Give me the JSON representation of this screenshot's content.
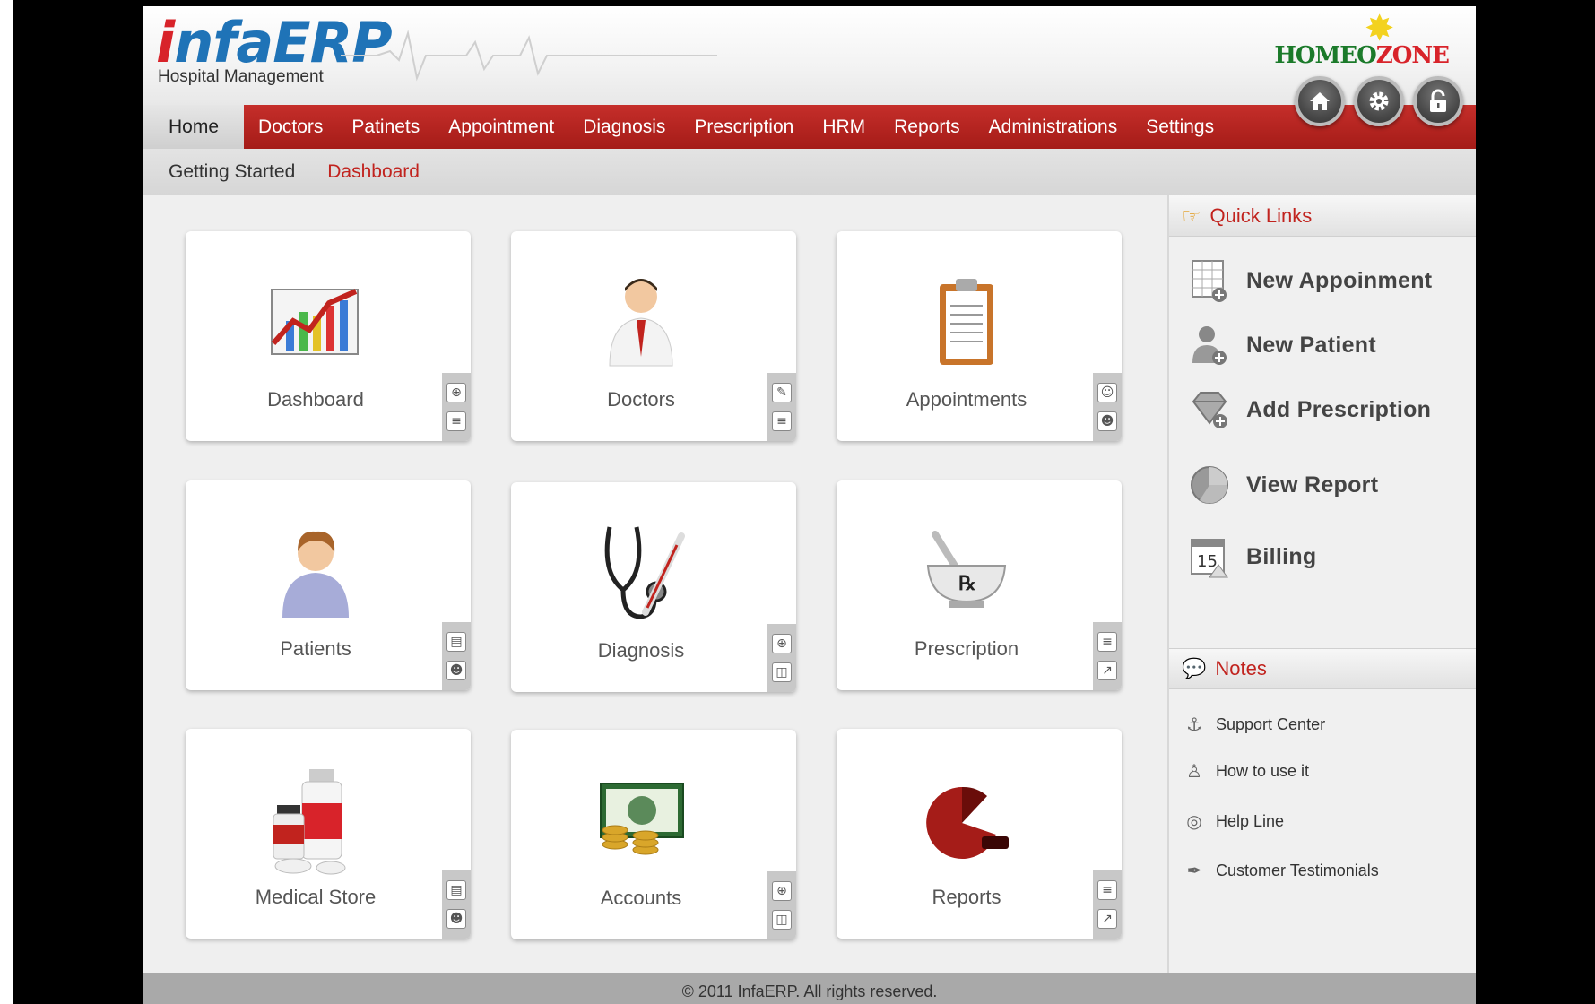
{
  "header": {
    "logo_i": "i",
    "logo_rest": "nfaERP",
    "logo_sub": "Hospital Management",
    "brand_left": "HOMEO",
    "brand_right": "ZONE",
    "round_buttons": [
      "home-icon",
      "gear-icon",
      "unlock-icon"
    ]
  },
  "nav": {
    "items": [
      "Home",
      "Doctors",
      "Patinets",
      "Appointment",
      "Diagnosis",
      "Prescription",
      "HRM",
      "Reports",
      "Administrations",
      "Settings"
    ]
  },
  "subnav": {
    "items": [
      "Getting Started",
      "Dashboard"
    ]
  },
  "cards": [
    {
      "label": "Dashboard",
      "icon": "chart-icon"
    },
    {
      "label": "Doctors",
      "icon": "doctor-icon"
    },
    {
      "label": "Appointments",
      "icon": "clipboard-icon"
    },
    {
      "label": "Patients",
      "icon": "patient-icon"
    },
    {
      "label": "Diagnosis",
      "icon": "stethoscope-icon"
    },
    {
      "label": "Prescription",
      "icon": "mortar-icon"
    },
    {
      "label": "Medical Store",
      "icon": "medicine-icon"
    },
    {
      "label": "Accounts",
      "icon": "money-icon"
    },
    {
      "label": "Reports",
      "icon": "pie-chart-icon"
    }
  ],
  "quick_links": {
    "title": "Quick Links",
    "items": [
      "New Appoinment",
      "New Patient",
      "Add Prescription",
      "View Report",
      "Billing"
    ],
    "billing_date": "15"
  },
  "notes": {
    "title": "Notes",
    "items": [
      "Support Center",
      "How to use it",
      "Help Line",
      "Customer Testimonials"
    ]
  },
  "footer": {
    "text": "© 2011 InfaERP. All rights reserved."
  },
  "colors": {
    "nav_red": "#b5231f",
    "accent_red": "#c1231e",
    "logo_blue": "#1f73b7"
  }
}
